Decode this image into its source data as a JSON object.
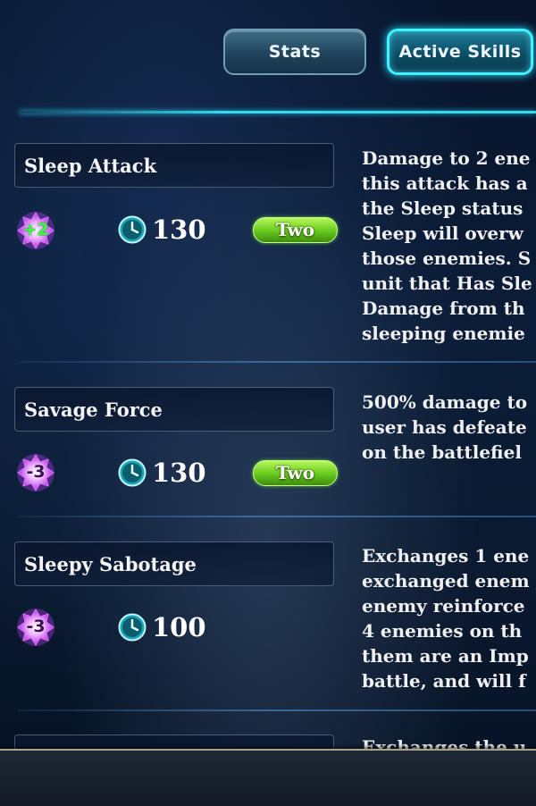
{
  "tabs": [
    {
      "label": "Stats",
      "active": false
    },
    {
      "label": "Active Skills",
      "active": true
    }
  ],
  "skills": [
    {
      "name": "Sleep Attack",
      "cost": "+2",
      "cooldown": "130",
      "target": "Two",
      "description_lines": [
        "Damage to 2 ene",
        "this attack has a",
        "the Sleep status",
        "Sleep will overw",
        "those enemies. S",
        "unit that Has Sle",
        "Damage from th",
        "sleeping enemie"
      ]
    },
    {
      "name": "Savage Force",
      "cost": "-3",
      "cooldown": "130",
      "target": "Two",
      "description_lines": [
        "500% damage to",
        "user has defeate",
        "on the battlefiel"
      ]
    },
    {
      "name": "Sleepy Sabotage",
      "cost": "-3",
      "cooldown": "100",
      "target": "",
      "description_lines": [
        "Exchanges 1 ene",
        "exchanged enem",
        "enemy reinforce",
        "4 enemies on th",
        "them are an Imp",
        "battle, and will f"
      ]
    },
    {
      "name": "",
      "cost": "",
      "cooldown": "",
      "target": "",
      "description_lines": [
        "Exchanges the u"
      ]
    }
  ],
  "icons": {
    "cost": "lotus-badge-icon",
    "cooldown": "clock-icon"
  },
  "colors": {
    "accent": "#3ff2ff",
    "target_pill": "#67c81c",
    "cost_plus": "#3bff3b",
    "badge_glow": "#e070ff"
  }
}
